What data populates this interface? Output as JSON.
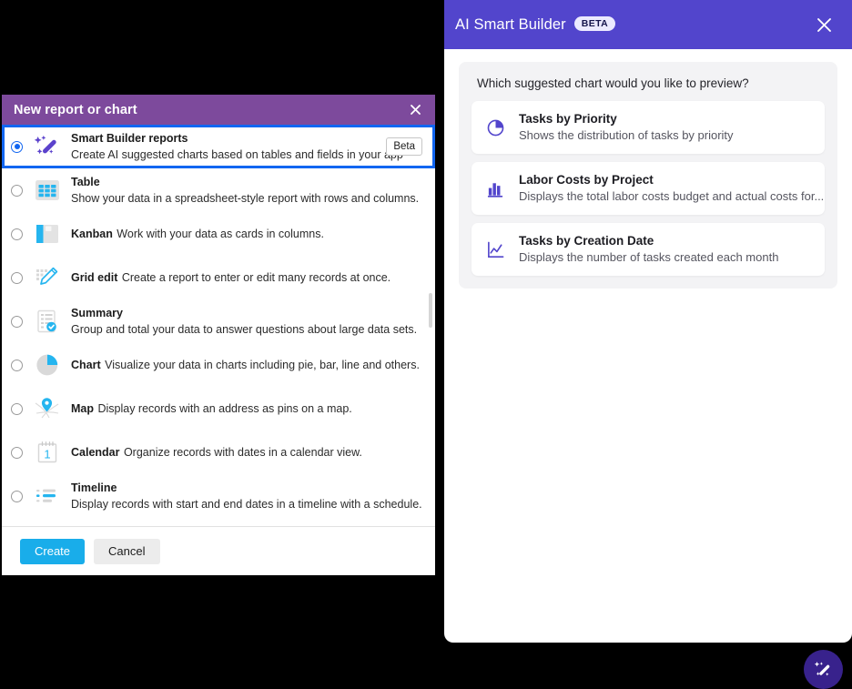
{
  "dialog": {
    "title": "New report or chart",
    "close_icon": "close-icon",
    "options": [
      {
        "id": "smart-builder",
        "title": "Smart Builder reports",
        "desc": "Create AI suggested charts based on tables and fields in your app",
        "icon": "magic-wand-icon",
        "selected": true,
        "badge": "Beta"
      },
      {
        "id": "table",
        "title": "Table",
        "desc": "Show your data in a spreadsheet-style report with rows and columns.",
        "icon": "table-grid-icon",
        "selected": false,
        "badge": ""
      },
      {
        "id": "kanban",
        "title": "Kanban",
        "desc": "Work with your data as cards in columns.",
        "icon": "kanban-board-icon",
        "selected": false,
        "badge": ""
      },
      {
        "id": "grid-edit",
        "title": "Grid edit",
        "desc": "Create a report to enter or edit many records at once.",
        "icon": "pencil-grid-icon",
        "selected": false,
        "badge": ""
      },
      {
        "id": "summary",
        "title": "Summary",
        "desc": "Group and total your data to answer questions about large data sets.",
        "icon": "summary-checklist-icon",
        "selected": false,
        "badge": ""
      },
      {
        "id": "chart",
        "title": "Chart",
        "desc": "Visualize your data in charts including pie, bar, line and others.",
        "icon": "pie-chart-icon",
        "selected": false,
        "badge": ""
      },
      {
        "id": "map",
        "title": "Map",
        "desc": "Display records with an address as pins on a map.",
        "icon": "map-pin-icon",
        "selected": false,
        "badge": ""
      },
      {
        "id": "calendar",
        "title": "Calendar",
        "desc": "Organize records with dates in a calendar view.",
        "icon": "calendar-icon",
        "selected": false,
        "badge": ""
      },
      {
        "id": "timeline",
        "title": "Timeline",
        "desc": "Display records with start and end dates in a timeline with a schedule.",
        "icon": "timeline-bars-icon",
        "selected": false,
        "badge": ""
      }
    ],
    "footer": {
      "create_label": "Create",
      "cancel_label": "Cancel"
    },
    "colors": {
      "header_purple": "#7d4a9c",
      "selection_blue": "#1266f1",
      "primary_button": "#19adea",
      "accent_cyan": "#19adea",
      "wand_purple": "#5b42cc"
    }
  },
  "ai_panel": {
    "title": "AI Smart Builder",
    "badge": "BETA",
    "close_icon": "close-icon",
    "question": "Which suggested chart would you like to preview?",
    "suggestions": [
      {
        "title": "Tasks by Priority",
        "desc": "Shows the distribution of tasks by priority",
        "icon": "pie-chart-icon"
      },
      {
        "title": "Labor Costs by Project",
        "desc": "Displays the total labor costs budget and actual costs for...",
        "icon": "bar-chart-icon"
      },
      {
        "title": "Tasks by Creation Date",
        "desc": "Displays the number of tasks created each month",
        "icon": "line-chart-icon"
      }
    ],
    "colors": {
      "header_purple": "#5245cc",
      "icon_purple": "#5245cc",
      "bubble_gray": "#f3f3f5"
    }
  },
  "fab": {
    "icon": "magic-wand-icon",
    "color": "#38228c"
  }
}
